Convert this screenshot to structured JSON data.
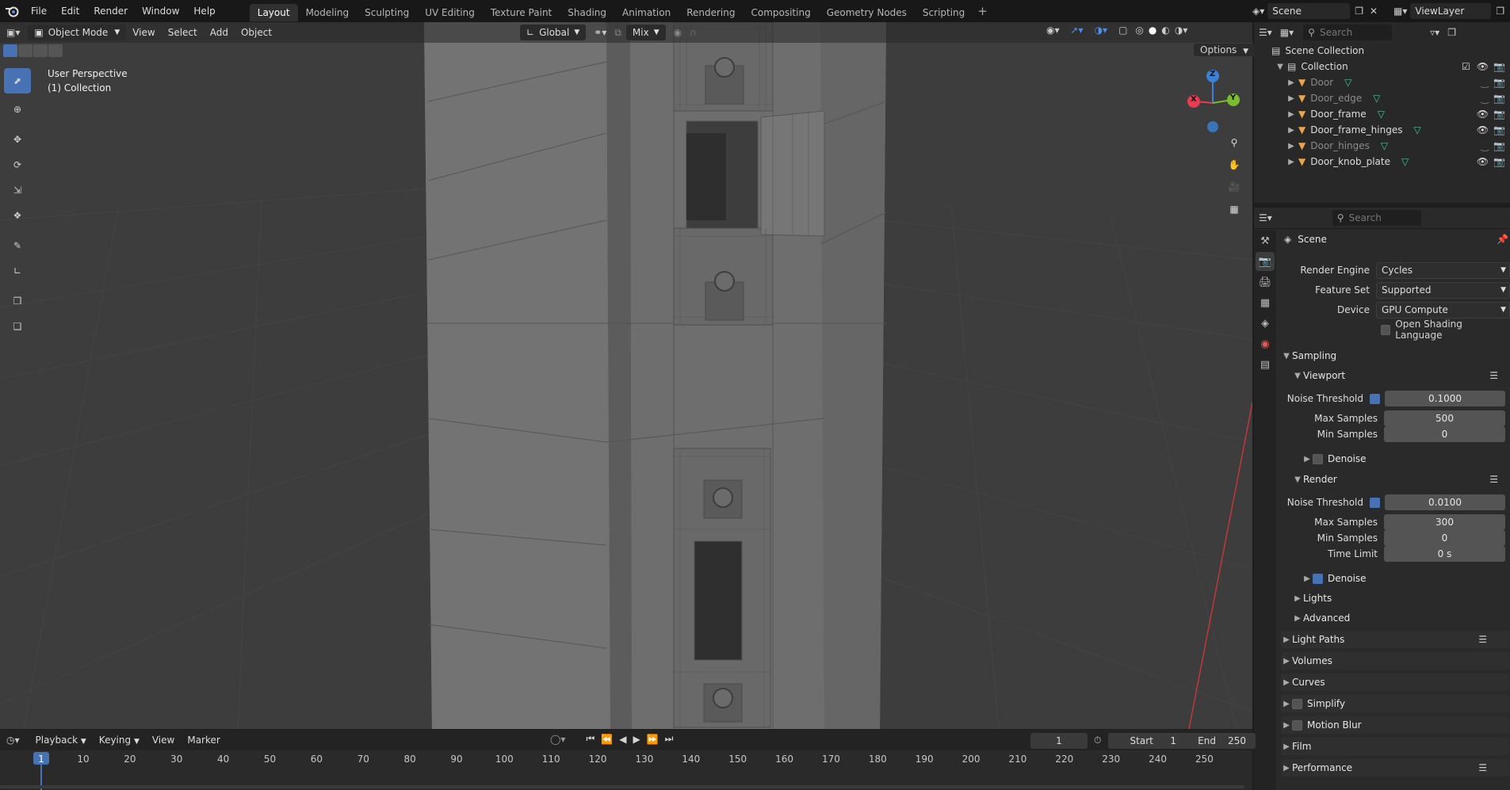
{
  "topbar": {
    "menus": [
      "File",
      "Edit",
      "Render",
      "Window",
      "Help"
    ],
    "workspaces": [
      "Layout",
      "Modeling",
      "Sculpting",
      "UV Editing",
      "Texture Paint",
      "Shading",
      "Animation",
      "Rendering",
      "Compositing",
      "Geometry Nodes",
      "Scripting"
    ],
    "active_workspace": "Layout",
    "scene": "Scene",
    "view_layer": "ViewLayer"
  },
  "viewport": {
    "mode": "Object Mode",
    "menus": [
      "View",
      "Select",
      "Add",
      "Object"
    ],
    "orientation": "Global",
    "snap": "Mix",
    "options_label": "Options",
    "overlay_title": "User Perspective",
    "overlay_subtitle": "(1) Collection",
    "axis_labels": {
      "x": "X",
      "y": "Y",
      "z": "Z"
    }
  },
  "outliner": {
    "search_placeholder": "Search",
    "root": "Scene Collection",
    "collection": "Collection",
    "items": [
      {
        "name": "Door",
        "visible": false
      },
      {
        "name": "Door_edge",
        "visible": false
      },
      {
        "name": "Door_frame",
        "visible": true
      },
      {
        "name": "Door_frame_hinges",
        "visible": true
      },
      {
        "name": "Door_hinges",
        "visible": false
      },
      {
        "name": "Door_knob_plate",
        "visible": true
      }
    ]
  },
  "properties": {
    "search_placeholder": "Search",
    "context": "Scene",
    "render_engine_label": "Render Engine",
    "render_engine": "Cycles",
    "feature_set_label": "Feature Set",
    "feature_set": "Supported",
    "device_label": "Device",
    "device": "GPU Compute",
    "osl_label": "Open Shading Language",
    "sampling_label": "Sampling",
    "viewport_label": "Viewport",
    "render_label": "Render",
    "noise_threshold_label": "Noise Threshold",
    "max_samples_label": "Max Samples",
    "min_samples_label": "Min Samples",
    "time_limit_label": "Time Limit",
    "denoise_label": "Denoise",
    "viewport_noise_threshold": "0.1000",
    "viewport_max_samples": "500",
    "viewport_min_samples": "0",
    "render_noise_threshold": "0.0100",
    "render_max_samples": "300",
    "render_min_samples": "0",
    "render_time_limit": "0 s",
    "lights_label": "Lights",
    "advanced_label": "Advanced",
    "panels": [
      "Light Paths",
      "Volumes",
      "Curves",
      "Simplify",
      "Motion Blur",
      "Film",
      "Performance"
    ]
  },
  "timeline": {
    "menus": [
      "Playback",
      "Keying",
      "View",
      "Marker"
    ],
    "current_frame": "1",
    "start_label": "Start",
    "start": "1",
    "end_label": "End",
    "end": "250",
    "ruler": [
      "1",
      "10",
      "20",
      "30",
      "40",
      "50",
      "60",
      "70",
      "80",
      "90",
      "100",
      "110",
      "120",
      "130",
      "140",
      "150",
      "160",
      "170",
      "180",
      "190",
      "200",
      "210",
      "220",
      "230",
      "240",
      "250"
    ]
  },
  "colors": {
    "accent": "#4772b3",
    "x_axis": "#e63c54",
    "y_axis": "#7cbd2f",
    "z_axis": "#3b82d6",
    "object_icon": "#e8a54b"
  }
}
